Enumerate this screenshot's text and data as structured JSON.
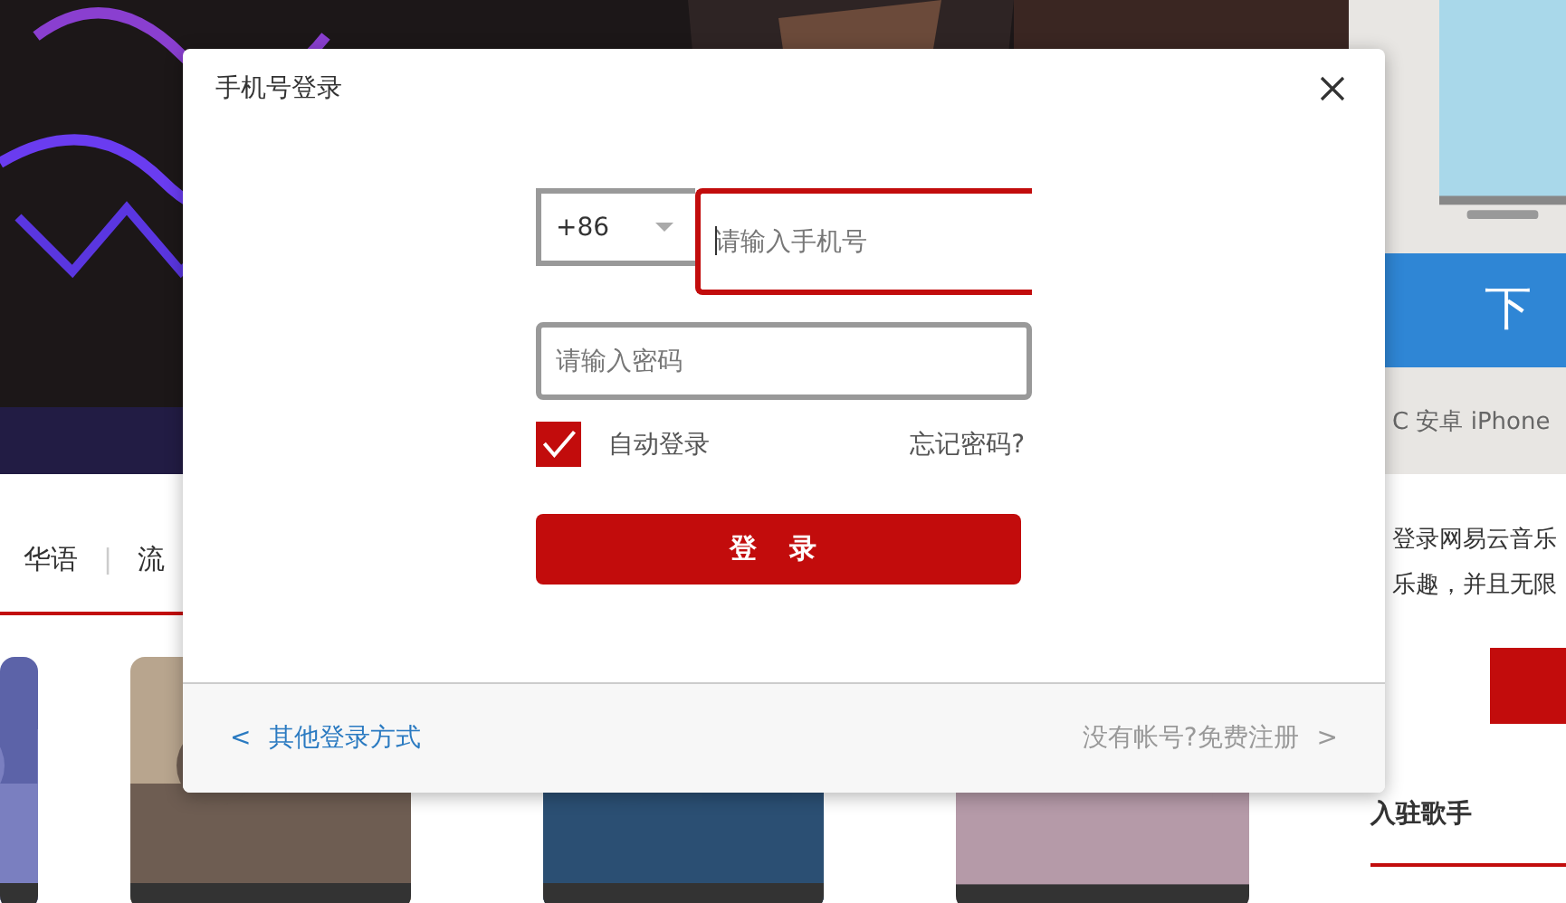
{
  "background_page": {
    "nav_tabs": [
      {
        "label": "华语"
      },
      {
        "label": "流"
      }
    ],
    "nav_separator": "|",
    "sidebar": {
      "download_button": "下",
      "platforms": "C 安卓 iPhone",
      "login_prompt": [
        "登录网易云音乐",
        "乐趣，并且无限"
      ],
      "section_title": "入驻歌手"
    }
  },
  "dialog": {
    "title": "手机号登录",
    "country_code": "+86",
    "phone": {
      "placeholder": "请输入手机号",
      "focused": true
    },
    "password": {
      "placeholder": "请输入密码",
      "focused": false
    },
    "auto_login": {
      "label": "自动登录",
      "checked": true
    },
    "forgot_link": "忘记密码?",
    "submit_button": "登录",
    "other_methods_link": {
      "arrow": "<",
      "label": "其他登录方式"
    },
    "register_link": {
      "label": "没有帐号?免费注册",
      "arrow": ">"
    }
  }
}
